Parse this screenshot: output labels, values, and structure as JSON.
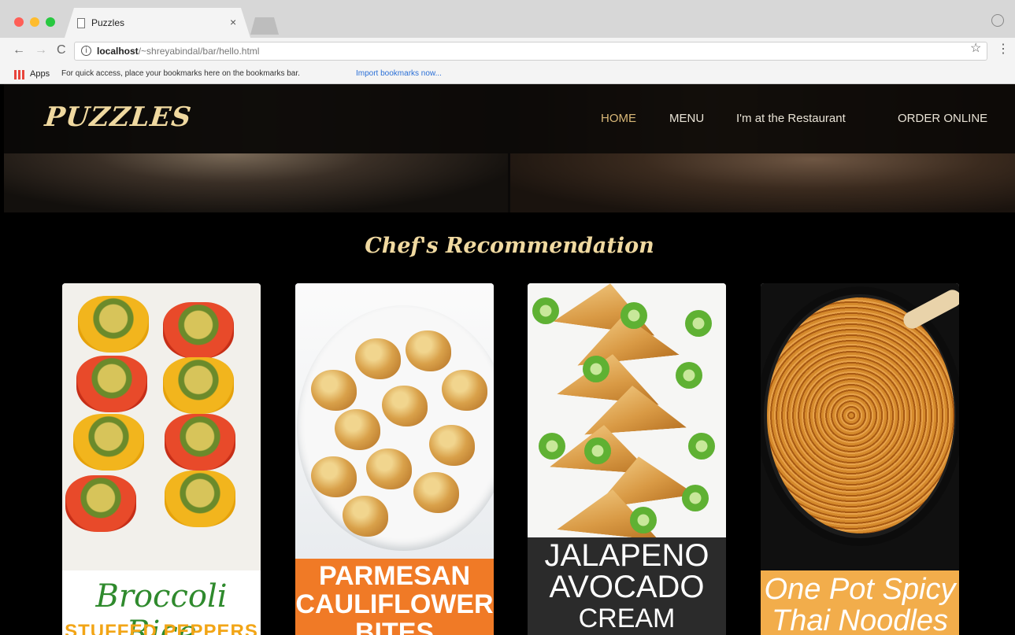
{
  "browser": {
    "tab_title": "Puzzles",
    "tab_close": "×",
    "url_host": "localhost",
    "url_path": "/~shreyabindal/bar/hello.html",
    "bookmarks": {
      "apps_label": "Apps",
      "hint": "For quick access, place your bookmarks here on the bookmarks bar.",
      "import_link": "Import bookmarks now..."
    }
  },
  "site": {
    "brand": "PUZZLES",
    "nav": [
      {
        "label": "HOME",
        "active": true
      },
      {
        "label": "MENU"
      },
      {
        "label": "I'm at the Restaurant"
      },
      {
        "label": "ORDER ONLINE"
      }
    ],
    "section_title": "Chef's Recommendation",
    "cards": [
      {
        "caption": [
          "Broccoli Rice",
          "STUFFED PEPPERS"
        ],
        "caption_color": "#2f8a2d"
      },
      {
        "caption": [
          "PARMESAN",
          "CAULIFLOWER",
          "BITES"
        ],
        "caption_color": "#f07a26"
      },
      {
        "caption": [
          "JALAPENO",
          "AVOCADO",
          "CREAM"
        ],
        "caption_color": "#2b2b2b"
      },
      {
        "caption": [
          "One Pot Spicy",
          "Thai Noodles"
        ],
        "caption_color": "#f2ad4b"
      }
    ]
  },
  "colors": {
    "accent_gold": "#f0d9a0",
    "nav_active": "#d9b878"
  }
}
